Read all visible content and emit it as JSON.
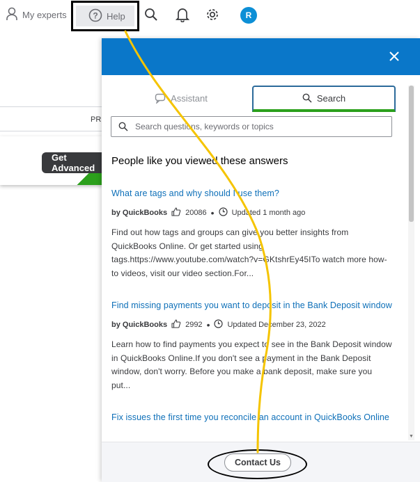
{
  "topnav": {
    "my_experts_label": "My experts",
    "help_label": "Help",
    "avatar_initial": "R"
  },
  "background": {
    "pri_text": "PRI",
    "get_advanced_label": "Get Advanced"
  },
  "help_panel": {
    "tabs": [
      {
        "label": "Assistant",
        "icon": "chat-bubble-icon",
        "active": false
      },
      {
        "label": "Search",
        "icon": "search-icon",
        "active": true
      }
    ],
    "search_placeholder": "Search questions, keywords or topics",
    "section_title": "People like you viewed these answers",
    "results": [
      {
        "title": "What are tags and why should I use them?",
        "author": "by QuickBooks",
        "likes": "20086",
        "updated": "Updated 1 month ago",
        "snippet": "Find out how tags and groups can give you better insights from QuickBooks Online. Or get started using tags.https://www.youtube.com/watch?v=GKtshrEy45ITo watch more how-to videos, visit our video section.For..."
      },
      {
        "title": "Find missing payments you want to deposit in the Bank Deposit window",
        "author": "by QuickBooks",
        "likes": "2992",
        "updated": "Updated December 23, 2022",
        "snippet": "Learn how to find payments you expect to see in the Bank Deposit window in QuickBooks Online.If you don't see a payment in the Bank Deposit window, don't worry. Before you make a bank deposit, make sure you put..."
      },
      {
        "title": "Fix issues the first time you reconcile an account in QuickBooks Online"
      }
    ],
    "contact_label": "Contact Us"
  },
  "colors": {
    "header_blue": "#0a77c9",
    "link_blue": "#0d6fb8",
    "avatar_blue": "#0d8fd6",
    "active_tab_underline": "#2ca01c",
    "annotation_yellow": "#f5c400"
  }
}
